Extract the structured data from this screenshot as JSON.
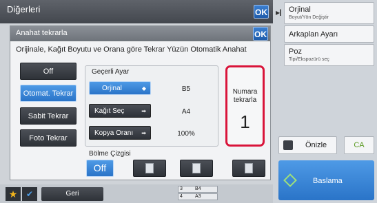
{
  "topbar": {
    "title": "Diğerleri",
    "ok_label": "OK"
  },
  "right_panel": {
    "original": {
      "label": "Orjinal",
      "sub": "Boyut/Yön Değiştir"
    },
    "background": {
      "label": "Arkaplan Ayarı"
    },
    "exposure": {
      "label": "Poz",
      "sub": "Tipi/Ekspozürü seç"
    },
    "preview": {
      "label": "Önizle"
    },
    "ca": {
      "label": "CA"
    },
    "start": {
      "label": "Baslama"
    }
  },
  "dialog": {
    "title": "Anahat tekrarla",
    "ok_label": "OK",
    "description": "Orijinale, Kağıt Boyutu ve Orana göre Tekrar Yüzün Otomatik Anahat",
    "modes": [
      {
        "label": "Off",
        "selected": false
      },
      {
        "label": "Otomat. Tekrar",
        "selected": true
      },
      {
        "label": "Sabit Tekrar",
        "selected": false
      },
      {
        "label": "Foto Tekrar",
        "selected": false
      }
    ],
    "current_settings": {
      "label": "Geçerli Ayar",
      "rows": [
        {
          "button": "Orjinal",
          "value": "B5",
          "selected": true
        },
        {
          "button": "Kağıt Seç",
          "value": "A4",
          "selected": false
        },
        {
          "button": "Kopya Oranı",
          "value": "100%",
          "selected": false
        }
      ]
    },
    "repeat_count": {
      "label": "Numara tekrarla",
      "value": "1"
    },
    "dividing_line": {
      "label": "Bölme Çizgisi",
      "off_label": "Off"
    }
  },
  "bottom": {
    "back_label": "Geri",
    "trays": [
      {
        "num": "3",
        "size": "B4"
      },
      {
        "num": "4",
        "size": "A3"
      }
    ]
  },
  "colors": {
    "accent": "#2a74c8",
    "highlight": "#d9143a",
    "ca_green": "#5a9a21"
  }
}
